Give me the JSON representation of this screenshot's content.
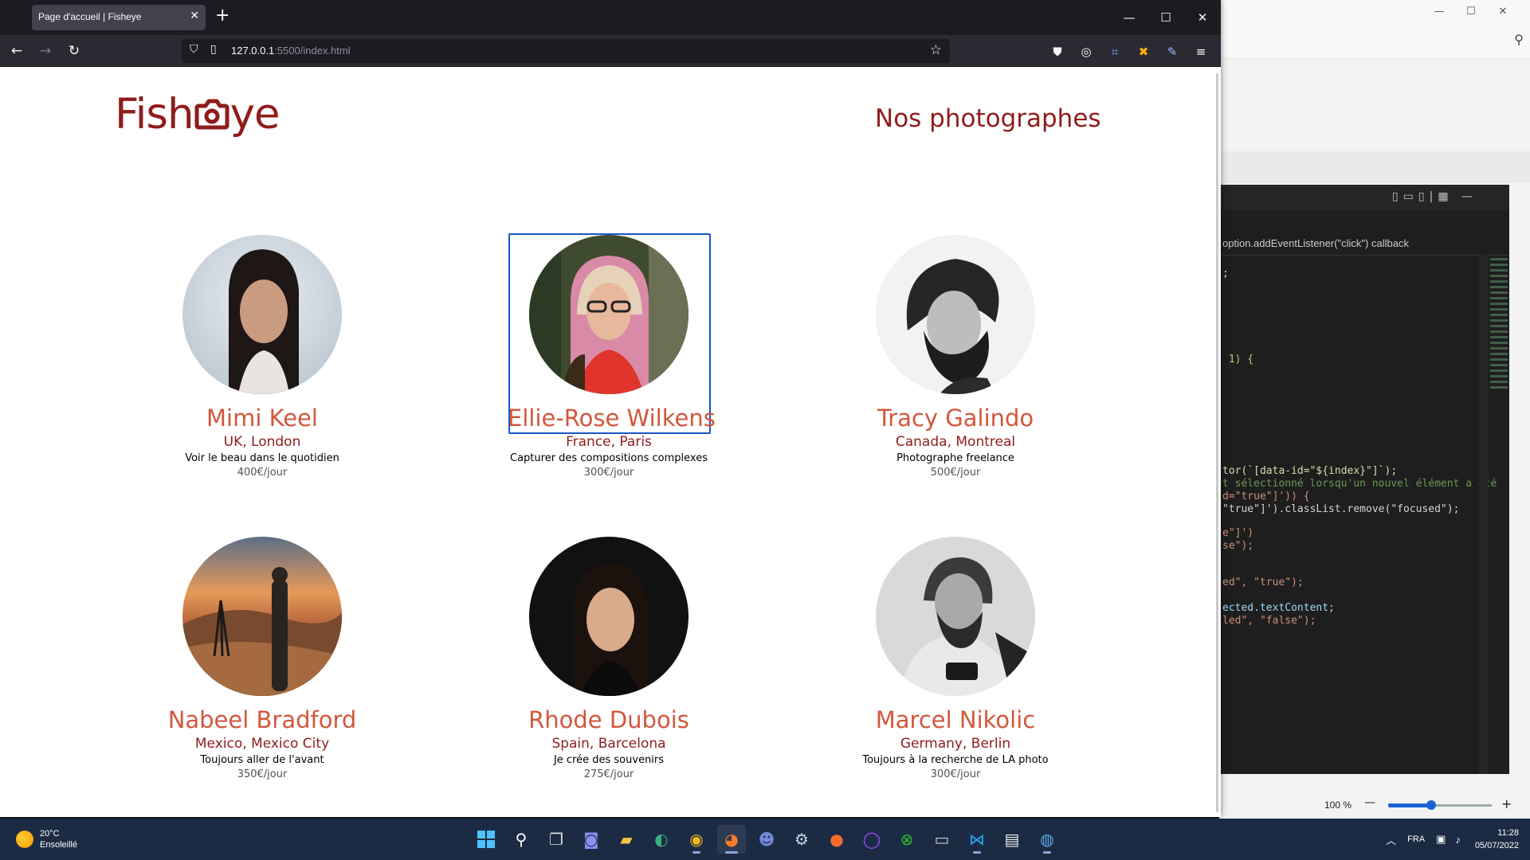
{
  "browser": {
    "tab_title": "Page d'accueil | Fisheye",
    "tab_close_glyph": "✕",
    "new_tab_glyph": "+",
    "url_host": "127.0.0.1",
    "url_path": ":5500/index.html",
    "window_controls": {
      "minimize": "—",
      "maximize": "☐",
      "close": "✕"
    },
    "toolbar_icons": [
      "pocket-icon",
      "compass-icon",
      "extension-icon",
      "tools-icon",
      "pen-icon",
      "menu-icon"
    ]
  },
  "site": {
    "logo_prefix": "Fish",
    "logo_suffix": "ye",
    "page_title": "Nos photographes",
    "brand_color": "#901C1C",
    "accent_color": "#D3573C",
    "focus_color": "#1A56C4"
  },
  "photographers": [
    {
      "name": "Mimi Keel",
      "location": "UK, London",
      "tagline": "Voir le beau dans le quotidien",
      "price": "400€/jour",
      "focused": false
    },
    {
      "name": "Ellie-Rose Wilkens",
      "location": "France, Paris",
      "tagline": "Capturer des compositions complexes",
      "price": "300€/jour",
      "focused": true
    },
    {
      "name": "Tracy Galindo",
      "location": "Canada, Montreal",
      "tagline": "Photographe freelance",
      "price": "500€/jour",
      "focused": false
    },
    {
      "name": "Nabeel Bradford",
      "location": "Mexico, Mexico City",
      "tagline": "Toujours aller de l'avant",
      "price": "350€/jour",
      "focused": false
    },
    {
      "name": "Rhode Dubois",
      "location": "Spain, Barcelona",
      "tagline": "Je crée des souvenirs",
      "price": "275€/jour",
      "focused": false
    },
    {
      "name": "Marcel Nikolic",
      "location": "Germany, Berlin",
      "tagline": "Toujours à la recherche de LA photo",
      "price": "300€/jour",
      "focused": false
    }
  ],
  "editor": {
    "breadcrumb": "option.addEventListener(\"click\") callback",
    "code_lines": [
      ";",
      " 1) {",
      "tor(`[data-id=\"${index}\"]`);",
      "t sélectionné lorsqu'un nouvel élément a été",
      "d=\"true\"]')) {",
      "\"true\"]').classList.remove(\"focused\");",
      "e\"]')",
      "se\");",
      "ed\", \"true\");",
      "ected.textContent;",
      "led\", \"false\");"
    ],
    "zoom": "100 %"
  },
  "taskbar": {
    "weather_temp": "20°C",
    "weather_desc": "Ensoleillé",
    "language": "FRA",
    "time": "11:28",
    "date": "05/07/2022",
    "apps": [
      "windows-start-icon",
      "search-icon",
      "task-view-icon",
      "teams-chat-icon",
      "file-explorer-icon",
      "edge-icon",
      "chrome-icon",
      "firefox-icon",
      "discord-icon",
      "steam-icon",
      "origin-icon",
      "app-circle-icon",
      "xbox-icon",
      "terminal-icon",
      "vscode-icon",
      "notes-icon",
      "globe-app-icon"
    ]
  }
}
